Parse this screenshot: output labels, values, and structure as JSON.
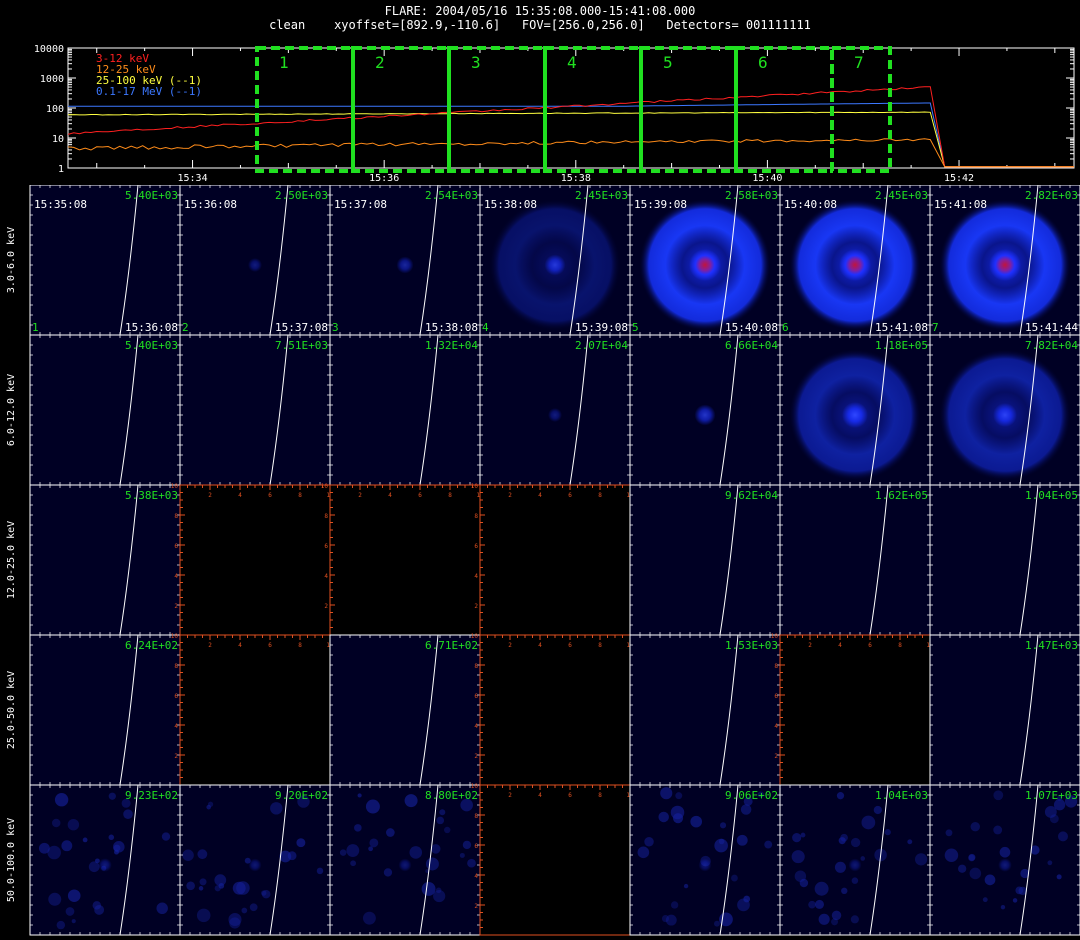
{
  "header": {
    "title": "FLARE: 2004/05/16 15:35:08.000-15:41:08.000",
    "subtitle": "clean    xyoffset=[892.9,-110.6]   FOV=[256.0,256.0]   Detectors= 001111111"
  },
  "lightcurve": {
    "y_ticks": [
      "10000",
      "1000",
      "100",
      "10",
      "1"
    ],
    "y_range": [
      1,
      10000
    ],
    "y_scale": "log",
    "x_ticks": [
      "15:34",
      "15:36",
      "15:38",
      "15:40",
      "15:42"
    ],
    "legend": [
      {
        "label": "3-12 keV",
        "color": "#ff2020"
      },
      {
        "label": "12-25 keV",
        "color": "#ff8c1a"
      },
      {
        "label": "25-100 keV (--1)",
        "color": "#ffff40"
      },
      {
        "label": "0.1-17 MeV (--1)",
        "color": "#3c78ff"
      }
    ],
    "interval_labels": [
      "1",
      "2",
      "3",
      "4",
      "5",
      "6",
      "7"
    ],
    "interval_color": "#20e020"
  },
  "grid": {
    "row_labels": [
      "3.0-6.0 keV",
      "6.0-12.0 keV",
      "12.0-25.0 keV",
      "25.0-50.0 keV",
      "50.0-100.0 keV"
    ],
    "start_times": [
      "15:35:08",
      "15:36:08",
      "15:37:08",
      "15:38:08",
      "15:39:08",
      "15:40:08",
      "15:41:08"
    ],
    "end_times": [
      "15:36:08",
      "15:37:08",
      "15:38:08",
      "15:39:08",
      "15:40:08",
      "15:41:08",
      "15:41:44"
    ],
    "interval_numbers": [
      "1",
      "2",
      "3",
      "4",
      "5",
      "6",
      "7"
    ],
    "axis_tick_labels": [
      "2",
      "4",
      "6",
      "8",
      "10"
    ],
    "cells": [
      [
        {
          "max": "5.40E+03",
          "type": "image",
          "src": 0
        },
        {
          "max": "2.50E+03",
          "type": "image",
          "src": 0.1
        },
        {
          "max": "2.54E+03",
          "type": "image",
          "src": 0.25
        },
        {
          "max": "2.45E+03",
          "type": "image",
          "src": 0.45,
          "halo": 0.35
        },
        {
          "max": "2.58E+03",
          "type": "image",
          "src": 1,
          "halo": 1
        },
        {
          "max": "2.45E+03",
          "type": "image",
          "src": 1,
          "halo": 1
        },
        {
          "max": "2.82E+03",
          "type": "image",
          "src": 1,
          "halo": 1
        }
      ],
      [
        {
          "max": "5.40E+03",
          "type": "image",
          "src": 0
        },
        {
          "max": "7.51E+03",
          "type": "image",
          "src": 0
        },
        {
          "max": "1.32E+04",
          "type": "image",
          "src": 0
        },
        {
          "max": "2.07E+04",
          "type": "image",
          "src": 0.1
        },
        {
          "max": "6.66E+04",
          "type": "image",
          "src": 0.45
        },
        {
          "max": "1.18E+05",
          "type": "image",
          "src": 0.7,
          "halo": 0.6
        },
        {
          "max": "7.82E+04",
          "type": "image",
          "src": 0.6,
          "halo": 0.6
        }
      ],
      [
        {
          "max": "5.38E+03",
          "type": "image",
          "src": 0
        },
        {
          "max": "",
          "type": "empty"
        },
        {
          "max": "",
          "type": "empty"
        },
        {
          "max": "",
          "type": "empty"
        },
        {
          "max": "9.62E+04",
          "type": "image",
          "src": 0
        },
        {
          "max": "1.62E+05",
          "type": "image",
          "src": 0
        },
        {
          "max": "1.04E+05",
          "type": "image",
          "src": 0
        }
      ],
      [
        {
          "max": "6.24E+02",
          "type": "image",
          "src": 0
        },
        {
          "max": "",
          "type": "empty"
        },
        {
          "max": "6.71E+02",
          "type": "image",
          "src": 0
        },
        {
          "max": "",
          "type": "empty"
        },
        {
          "max": "1.53E+03",
          "type": "image",
          "src": 0
        },
        {
          "max": "",
          "type": "empty"
        },
        {
          "max": "1.47E+03",
          "type": "image",
          "src": 0
        }
      ],
      [
        {
          "max": "9.23E+02",
          "type": "image",
          "src": 0.08
        },
        {
          "max": "9.20E+02",
          "type": "image",
          "src": 0.05
        },
        {
          "max": "8.80E+02",
          "type": "image",
          "src": 0.05
        },
        {
          "max": "",
          "type": "empty"
        },
        {
          "max": "9.06E+02",
          "type": "image",
          "src": 0.05
        },
        {
          "max": "1.04E+03",
          "type": "image",
          "src": 0.05
        },
        {
          "max": "1.07E+03",
          "type": "image",
          "src": 0.08
        }
      ]
    ]
  },
  "colors": {
    "panel_bg": "#000024",
    "label_green": "#20e020",
    "empty_axis": "#e05020",
    "limb": "#ffffff",
    "source_blue": "#1a30ff",
    "source_core": "#c0143c"
  }
}
